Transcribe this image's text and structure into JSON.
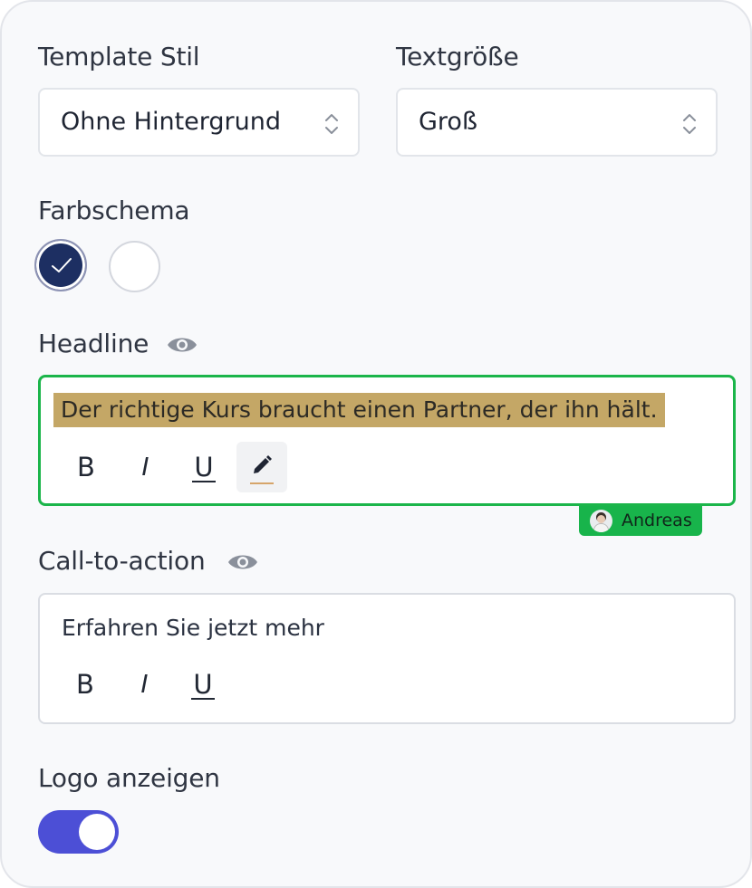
{
  "template_style": {
    "label": "Template Stil",
    "value": "Ohne Hintergrund"
  },
  "text_size": {
    "label": "Textgröße",
    "value": "Groß"
  },
  "color_scheme": {
    "label": "Farbschema",
    "options": [
      {
        "name": "navy",
        "color": "#1d2f62",
        "selected": true
      },
      {
        "name": "white",
        "color": "#ffffff",
        "selected": false
      }
    ]
  },
  "headline": {
    "label": "Headline",
    "visibility_icon": "eye-icon",
    "text": "Der richtige Kurs braucht einen Partner, der ihn hält.",
    "highlight_color": "#c4a766",
    "toolbar": {
      "bold": "B",
      "italic": "I",
      "underline": "U",
      "color_tool_icon": "pencil-icon"
    },
    "collaborator": {
      "name": "Andreas",
      "color": "#18b44b"
    }
  },
  "cta": {
    "label": "Call-to-action",
    "visibility_icon": "eye-icon",
    "text": "Erfahren Sie jetzt mehr",
    "toolbar": {
      "bold": "B",
      "italic": "I",
      "underline": "U"
    }
  },
  "logo": {
    "label": "Logo anzeigen",
    "enabled": true,
    "toggle_color": "#4c4fd6"
  }
}
